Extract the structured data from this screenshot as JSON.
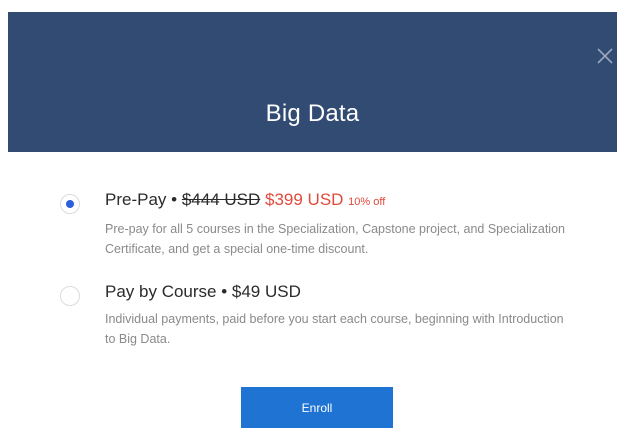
{
  "modal": {
    "title": "Big Data",
    "close_icon": "close-icon"
  },
  "options": {
    "prepay": {
      "selected": true,
      "label": "Pre-Pay",
      "separator": " • ",
      "original_price": "$444 USD",
      "price": "$399 USD",
      "discount": "10% off",
      "description": "Pre-pay for all 5 courses in the Specialization, Capstone project, and Specialization Certificate, and get a special one-time discount."
    },
    "by_course": {
      "selected": false,
      "label": "Pay by Course • $49 USD",
      "description": "Individual payments, paid before you start each course, beginning with Introduction to Big Data."
    }
  },
  "actions": {
    "enroll_label": "Enroll"
  },
  "colors": {
    "header_bg": "#324b73",
    "accent_red": "#e14a3b",
    "radio_selected": "#2c5fdb",
    "button_bg": "#1f73d2"
  }
}
